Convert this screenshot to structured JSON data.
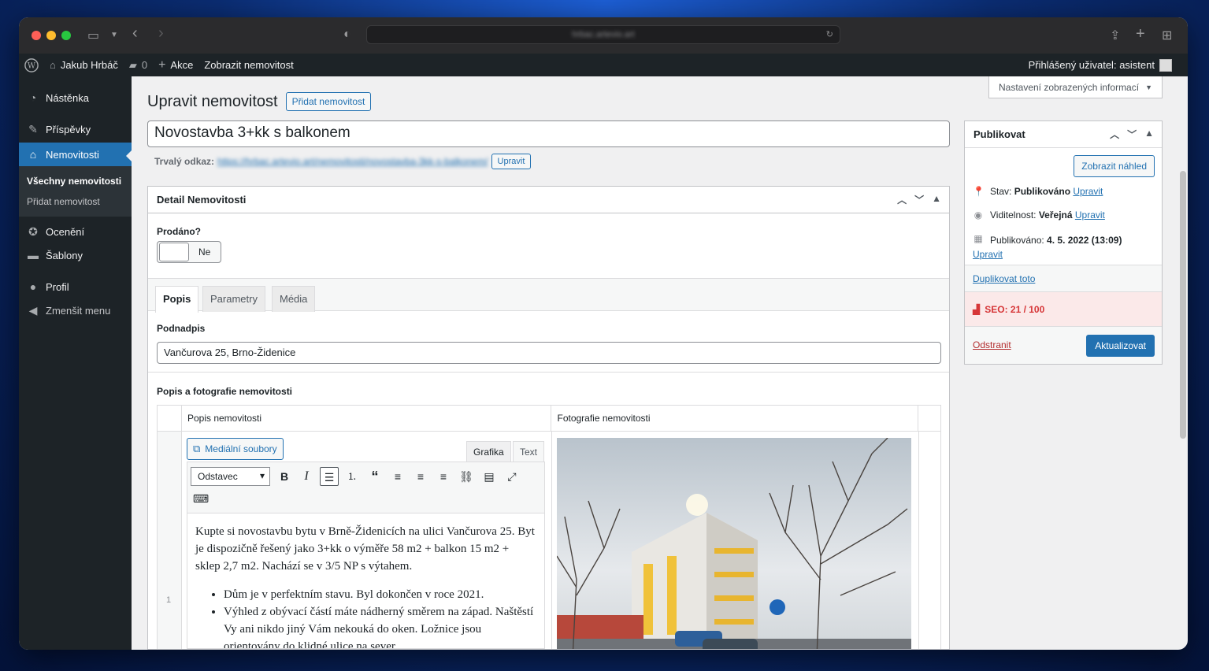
{
  "browser": {
    "url": "hrbac.artevio.art"
  },
  "adminbar": {
    "site_name": "Jakub Hrbáč",
    "comments_count": "0",
    "new_label": "Akce",
    "view_label": "Zobrazit nemovitost",
    "user_prefix": "Přihlášený uživatel: ",
    "user_name": "asistent"
  },
  "sidebar": {
    "items": [
      {
        "label": "Nástěnka"
      },
      {
        "label": "Příspěvky"
      },
      {
        "label": "Nemovitosti"
      },
      {
        "label": "Ocenění"
      },
      {
        "label": "Šablony"
      },
      {
        "label": "Profil"
      },
      {
        "label": "Zmenšit menu"
      }
    ],
    "submenu": [
      "Všechny nemovitosti",
      "Přidat nemovitost"
    ]
  },
  "screen_options": "Nastavení zobrazených informací",
  "page": {
    "title": "Upravit nemovitost",
    "add_new": "Přidat nemovitost",
    "post_title": "Novostavba 3+kk s balkonem",
    "permalink_label": "Trvalý odkaz:",
    "permalink_url": "https://hrbac.artevio.art/nemovitosti/novostavba-3kk-s-balkonem/",
    "permalink_edit": "Upravit"
  },
  "detail": {
    "title": "Detail Nemovitosti",
    "sold_label": "Prodáno?",
    "sold_value": "Ne",
    "tabs": [
      "Popis",
      "Parametry",
      "Média"
    ],
    "subtitle_label": "Podnadpis",
    "subtitle_value": "Vančurova 25, Brno-Židenice",
    "section_label": "Popis a fotografie nemovitosti",
    "col_desc": "Popis nemovitosti",
    "col_photo": "Fotografie nemovitosti",
    "row_number": "1",
    "media_button": "Mediální soubory",
    "editor_tabs": [
      "Grafika",
      "Text"
    ],
    "format_select": "Odstavec",
    "paragraph": "Kupte si novostavbu bytu v Brně-Židenicích na ulici Vančurova 25. Byt je dispozičně řešený jako 3+kk o výměře 58 m2 + balkon 15 m2 + sklep 2,7 m2. Nachází se v 3/5 NP s výtahem.",
    "bullets": [
      "Dům je v perfektním stavu. Byl dokončen v roce 2021.",
      "Výhled z obývací částí máte nádherný směrem na západ. Naštěstí Vy ani nikdo jiný Vám nekouká do oken. Ložnice jsou orientovány do klidné ulice na sever."
    ]
  },
  "publish": {
    "title": "Publikovat",
    "preview_button": "Zobrazit náhled",
    "status_label": "Stav: ",
    "status_value": "Publikováno",
    "visibility_label": "Viditelnost: ",
    "visibility_value": "Veřejná",
    "published_label": "Publikováno: ",
    "published_value": "4. 5. 2022 (13:09)",
    "edit_link": "Upravit",
    "duplicate": "Duplikovat toto",
    "seo": "SEO: 21 / 100",
    "delete": "Odstranit",
    "update": "Aktualizovat"
  },
  "colors": {
    "accent": "#2271b1",
    "admin_dark": "#1d2327",
    "seo_red": "#d63638"
  }
}
